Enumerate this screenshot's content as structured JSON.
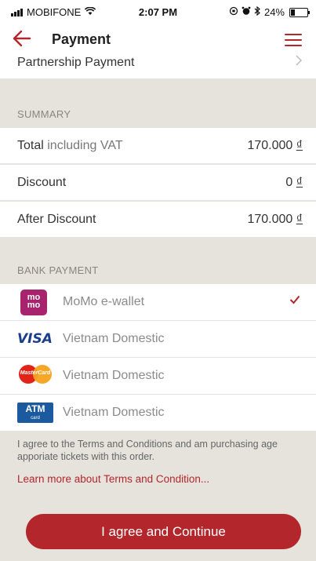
{
  "status_bar": {
    "carrier": "MOBIFONE",
    "time": "2:07 PM",
    "battery": "24%"
  },
  "header": {
    "title": "Payment",
    "partnership_label": "Partnership Payment"
  },
  "summary": {
    "section_title": "SUMMARY",
    "rows": [
      {
        "label_main": "Total",
        "label_rest": " including VAT",
        "value": "170.000",
        "currency": "₫"
      },
      {
        "label_main": "Discount",
        "label_rest": "",
        "value": "0",
        "currency": "₫"
      },
      {
        "label_main": "After Discount",
        "label_rest": "",
        "value": "170.000",
        "currency": "₫"
      }
    ]
  },
  "bank_payment": {
    "section_title": "BANK PAYMENT",
    "methods": [
      {
        "name": "MoMo e-wallet",
        "logo": "momo",
        "logo_text": "mo mo",
        "selected": true
      },
      {
        "name": "Vietnam Domestic",
        "logo": "visa",
        "logo_text": "VISA",
        "selected": false
      },
      {
        "name": "Vietnam Domestic",
        "logo": "mastercard",
        "logo_text": "MasterCard",
        "selected": false
      },
      {
        "name": "Vietnam Domestic",
        "logo": "atm",
        "logo_text": "ATM",
        "logo_subtext": "card",
        "selected": false
      }
    ]
  },
  "terms": {
    "text": "I agree to the Terms and Conditions and am purchasing age apporiate tickets with this order.",
    "link": "Learn more about Terms and Condition..."
  },
  "actions": {
    "continue_label": "I agree and Continue"
  },
  "colors": {
    "accent": "#b3262b",
    "background": "#e6e2dc",
    "momo": "#a7236e",
    "visa": "#1a3e8c"
  }
}
